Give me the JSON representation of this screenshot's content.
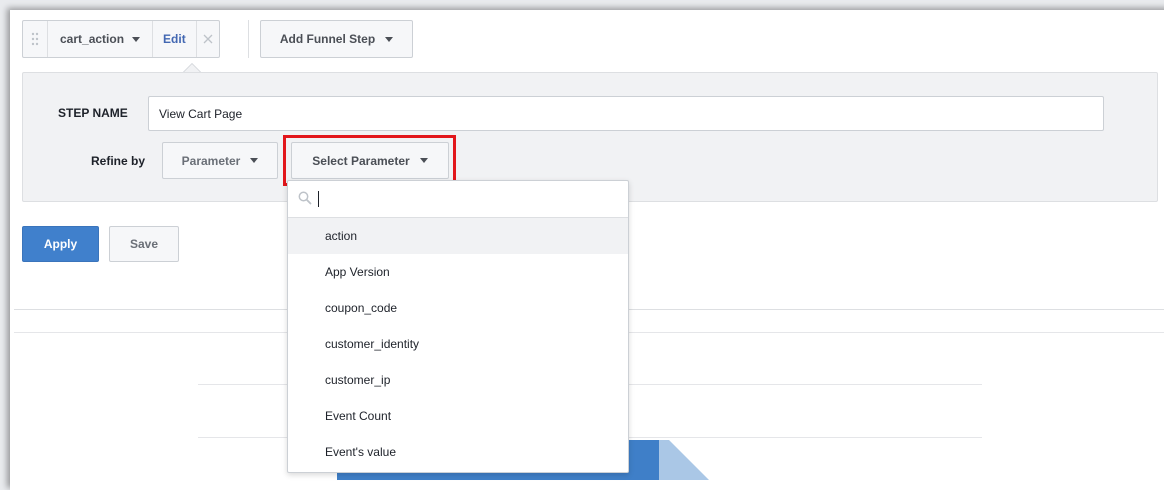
{
  "toolbar": {
    "event_label": "cart_action",
    "edit_label": "Edit",
    "add_step_label": "Add Funnel Step"
  },
  "step": {
    "name_label": "STEP NAME",
    "name_value": "View Cart Page",
    "refine_label": "Refine by",
    "parameter_button": "Parameter",
    "select_parameter_button": "Select Parameter"
  },
  "actions": {
    "apply": "Apply",
    "save": "Save"
  },
  "dropdown": {
    "search_value": "",
    "items": [
      "action",
      "App Version",
      "coupon_code",
      "customer_identity",
      "customer_ip",
      "Event Count",
      "Event's value"
    ],
    "active_index": 0
  },
  "colors": {
    "accent": "#4080cc",
    "highlight": "#e2161b",
    "bar_primary": "#3f7fc8",
    "bar_secondary": "#aac7e6"
  }
}
